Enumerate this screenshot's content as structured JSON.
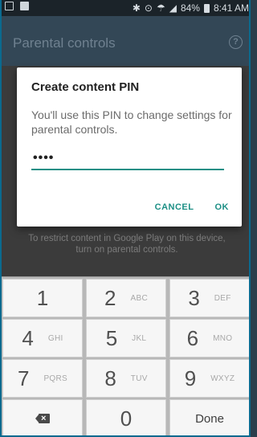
{
  "status_bar": {
    "bluetooth_icon": "bluetooth-icon",
    "alarm_icon": "alarm-icon",
    "wifi_icon": "wifi-icon",
    "signal_icon": "signal-icon",
    "battery": "84%",
    "time": "8:41 AM"
  },
  "app_bar": {
    "title": "Parental controls",
    "help_icon": "help-icon"
  },
  "background": {
    "text": "To restrict content in Google Play on this device, turn on parental controls."
  },
  "dialog": {
    "title": "Create content PIN",
    "message": "You'll use this PIN to change settings for parental controls.",
    "pin_value": "••••",
    "cancel_label": "CANCEL",
    "ok_label": "OK"
  },
  "keypad": {
    "rows": [
      [
        {
          "digit": "1",
          "letters": ""
        },
        {
          "digit": "2",
          "letters": "ABC"
        },
        {
          "digit": "3",
          "letters": "DEF"
        }
      ],
      [
        {
          "digit": "4",
          "letters": "GHI"
        },
        {
          "digit": "5",
          "letters": "JKL"
        },
        {
          "digit": "6",
          "letters": "MNO"
        }
      ],
      [
        {
          "digit": "7",
          "letters": "PQRS"
        },
        {
          "digit": "8",
          "letters": "TUV"
        },
        {
          "digit": "9",
          "letters": "WXYZ"
        }
      ]
    ],
    "zero": "0",
    "done_label": "Done",
    "backspace_icon": "backspace-icon"
  },
  "colors": {
    "accent": "#1c8f85",
    "dim_background": "#3b3b3b"
  }
}
